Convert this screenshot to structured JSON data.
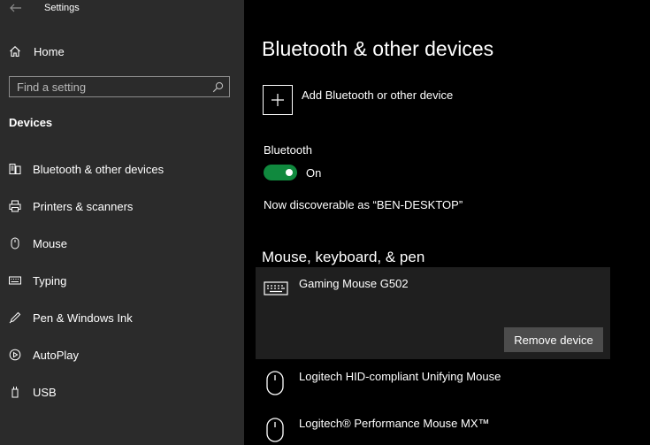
{
  "window": {
    "app_title": "Settings"
  },
  "sidebar": {
    "home_label": "Home",
    "search_placeholder": "Find a setting",
    "section_title": "Devices",
    "items": [
      {
        "label": "Bluetooth & other devices",
        "icon": "bluetooth-devices-icon"
      },
      {
        "label": "Printers & scanners",
        "icon": "printer-icon"
      },
      {
        "label": "Mouse",
        "icon": "mouse-icon"
      },
      {
        "label": "Typing",
        "icon": "keyboard-icon"
      },
      {
        "label": "Pen & Windows Ink",
        "icon": "pen-icon"
      },
      {
        "label": "AutoPlay",
        "icon": "autoplay-icon"
      },
      {
        "label": "USB",
        "icon": "usb-icon"
      }
    ]
  },
  "main": {
    "title": "Bluetooth & other devices",
    "add_device_label": "Add Bluetooth or other device",
    "bluetooth_label": "Bluetooth",
    "bluetooth_state": "On",
    "discoverable_text": "Now discoverable as “BEN-DESKTOP”",
    "section_heading": "Mouse, keyboard, & pen",
    "selected_device": {
      "name": "Gaming Mouse G502",
      "icon": "keyboard-icon",
      "remove_label": "Remove device"
    },
    "devices": [
      {
        "name": "Logitech HID-compliant Unifying Mouse",
        "icon": "mouse-icon"
      },
      {
        "name": "Logitech® Performance Mouse MX™",
        "icon": "mouse-icon"
      }
    ]
  },
  "colors": {
    "sidebar_bg": "#2b2b2b",
    "main_bg": "#000000",
    "accent_toggle": "#10893e",
    "button_bg": "#4c4c4c",
    "card_bg": "#1f1f1f"
  }
}
